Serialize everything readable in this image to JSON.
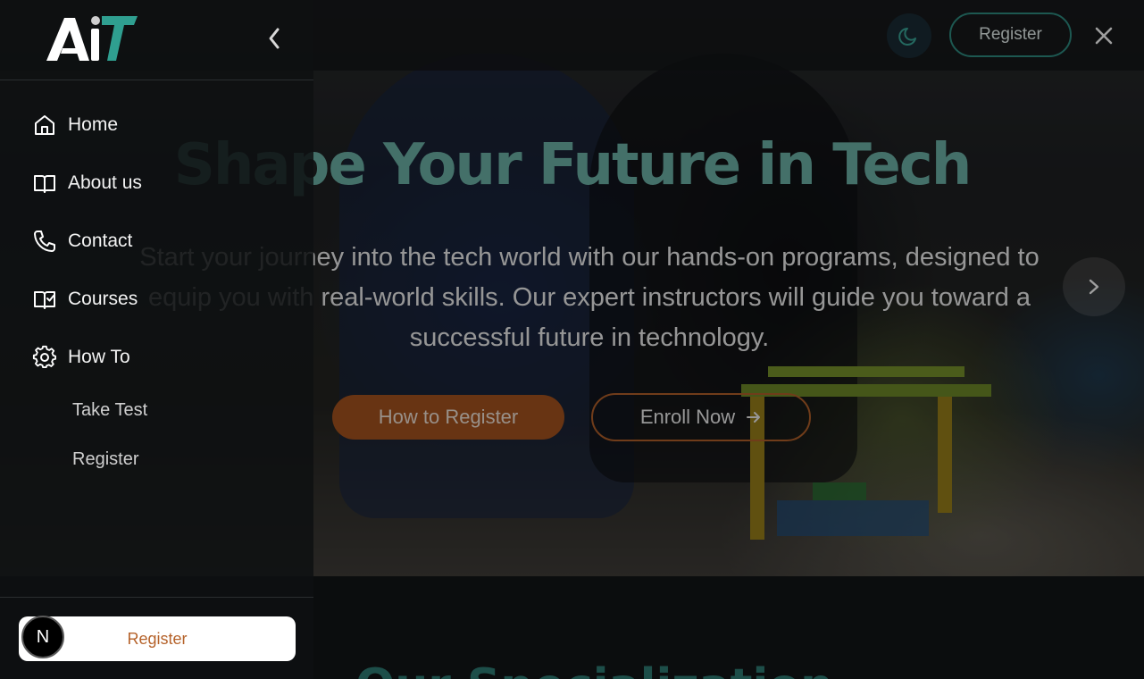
{
  "hero": {
    "title": "Shape Your Future in Tech",
    "description": "Start your journey into the tech world with our hands-on programs, designed to equip you with real-world skills. Our expert instructors will guide you toward a successful future in technology.",
    "primary_button": "How to Register",
    "secondary_button": "Enroll Now",
    "secondary_button_icon": "arrow-right-icon",
    "next_icon": "chevron-right-icon"
  },
  "topbar": {
    "theme_icon": "moon-icon",
    "register_label": "Register",
    "close_icon": "close-icon"
  },
  "sidebar": {
    "logo_text": "AiT",
    "collapse_icon": "chevron-left-icon",
    "items": [
      {
        "label": "Home",
        "icon": "home-icon"
      },
      {
        "label": "About us",
        "icon": "book-open-icon"
      },
      {
        "label": "Contact",
        "icon": "phone-icon"
      },
      {
        "label": "Courses",
        "icon": "book-check-icon"
      },
      {
        "label": "How To",
        "icon": "gear-icon"
      }
    ],
    "sub_items": [
      {
        "label": "Take Test"
      },
      {
        "label": "Register"
      }
    ],
    "footer_register": "Register"
  },
  "section": {
    "heading": "Our Specialization"
  },
  "avatar": {
    "initial": "N"
  },
  "colors": {
    "accent_teal": "#2f8f84",
    "accent_orange": "#a8541f",
    "background": "#0f1316"
  }
}
